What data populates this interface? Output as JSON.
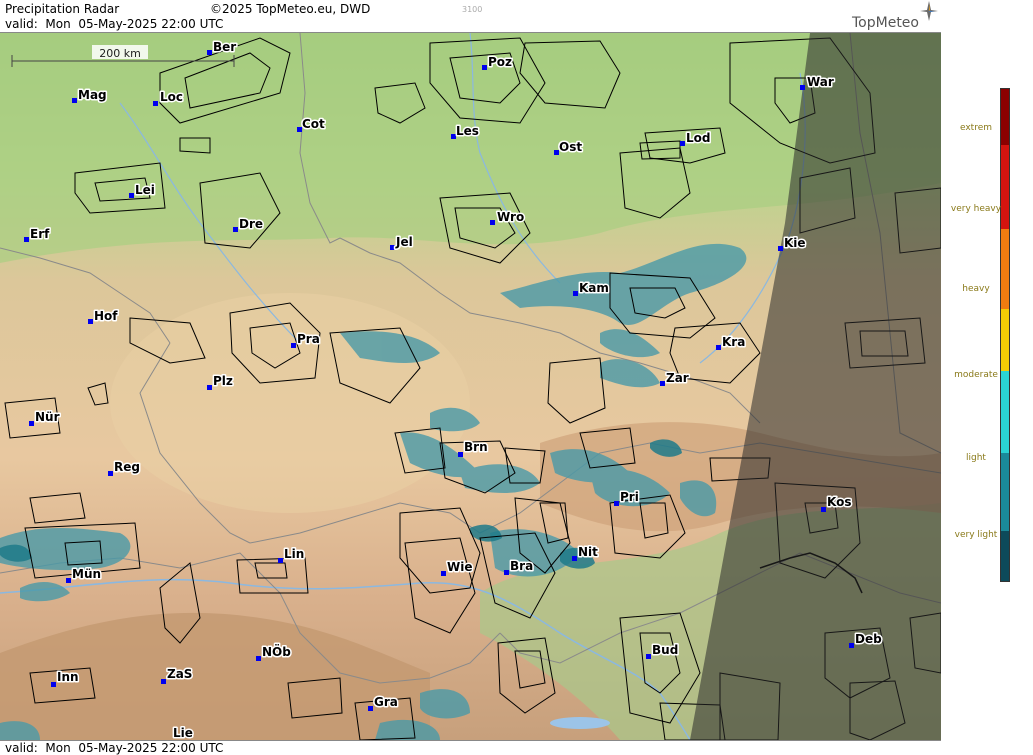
{
  "header": {
    "title": "Precipitation Radar",
    "copyright": "©2025 TopMeteo.eu, DWD",
    "valid": "valid:  Mon  05-May-2025 22:00 UTC",
    "code": "3100",
    "logo_text": "TopMeteo"
  },
  "footer": {
    "valid": "valid:  Mon  05-May-2025 22:00 UTC"
  },
  "map": {
    "scale_label": "200 km",
    "cities": [
      {
        "id": "ber",
        "label": "Ber"
      },
      {
        "id": "poz",
        "label": "Poz"
      },
      {
        "id": "war",
        "label": "War"
      },
      {
        "id": "mag",
        "label": "Mag"
      },
      {
        "id": "loc",
        "label": "Loc"
      },
      {
        "id": "cot",
        "label": "Cot"
      },
      {
        "id": "les",
        "label": "Les"
      },
      {
        "id": "ost",
        "label": "Ost"
      },
      {
        "id": "lod",
        "label": "Lod"
      },
      {
        "id": "lei",
        "label": "Lei"
      },
      {
        "id": "dre",
        "label": "Dre"
      },
      {
        "id": "wro",
        "label": "Wro"
      },
      {
        "id": "erf",
        "label": "Erf"
      },
      {
        "id": "jel",
        "label": "Jel"
      },
      {
        "id": "kie",
        "label": "Kie"
      },
      {
        "id": "kam",
        "label": "Kam"
      },
      {
        "id": "hof",
        "label": "Hof"
      },
      {
        "id": "pra",
        "label": "Pra"
      },
      {
        "id": "kra",
        "label": "Kra"
      },
      {
        "id": "plz",
        "label": "Plz"
      },
      {
        "id": "zar",
        "label": "Zar"
      },
      {
        "id": "nur",
        "label": "Nür"
      },
      {
        "id": "brn",
        "label": "Brn"
      },
      {
        "id": "reg",
        "label": "Reg"
      },
      {
        "id": "pri",
        "label": "Pri"
      },
      {
        "id": "kos",
        "label": "Kos"
      },
      {
        "id": "nit",
        "label": "Nit"
      },
      {
        "id": "lin",
        "label": "Lin"
      },
      {
        "id": "wie",
        "label": "Wie"
      },
      {
        "id": "bra",
        "label": "Bra"
      },
      {
        "id": "mun",
        "label": "Mün"
      },
      {
        "id": "deb",
        "label": "Deb"
      },
      {
        "id": "bud",
        "label": "Bud"
      },
      {
        "id": "nob",
        "label": "NÖb"
      },
      {
        "id": "inn",
        "label": "Inn"
      },
      {
        "id": "zas",
        "label": "ZaS"
      },
      {
        "id": "gra",
        "label": "Gra"
      },
      {
        "id": "lie",
        "label": "Lie"
      }
    ]
  },
  "legend": {
    "labels": [
      "extrem",
      "very heavy",
      "heavy",
      "moderate",
      "light",
      "very light"
    ],
    "colors": [
      "#8b0000",
      "#d4140f",
      "#f07c10",
      "#f4cc05",
      "#2ad4d4",
      "#1a8a9a",
      "#0d4a5a"
    ]
  }
}
